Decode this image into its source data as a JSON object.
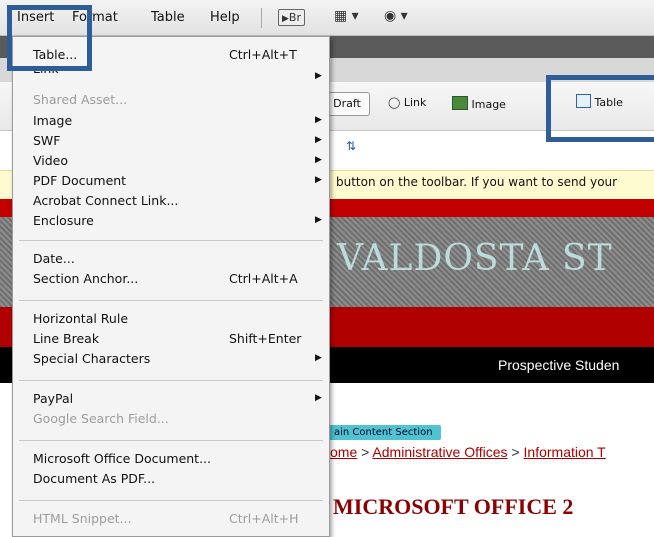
{
  "menubar": {
    "items": [
      "Insert",
      "Format",
      "Table",
      "Help"
    ],
    "br_icon_label": "Br"
  },
  "toolbar": {
    "draft_label": "Draft",
    "link_label": "Link",
    "image_label": "Image",
    "table_label": "Table"
  },
  "notice": {
    "text": "button on the toolbar. If you want to send your"
  },
  "page": {
    "banner_text": "VALDOSTA ST",
    "nav_text": "Prospective Studen",
    "content_tag": "ain Content Section",
    "breadcrumb": [
      "ome",
      "Administrative Offices",
      "Information T"
    ],
    "breadcrumb_sep": " > ",
    "heading": "MICROSOFT OFFICE 2"
  },
  "dropdown": {
    "items": [
      {
        "label": "Table...",
        "shortcut": "Ctrl+Alt+T",
        "disabled": false
      },
      {
        "label": "Link",
        "shortcut": "",
        "submenu": true
      },
      {
        "label": "Shared Asset...",
        "shortcut": "",
        "disabled": true
      },
      {
        "label": "Image",
        "shortcut": "",
        "submenu": true
      },
      {
        "label": "SWF",
        "shortcut": "",
        "submenu": true
      },
      {
        "label": "Video",
        "shortcut": "",
        "submenu": true
      },
      {
        "label": "PDF Document",
        "shortcut": "",
        "submenu": true
      },
      {
        "label": "Acrobat Connect Link...",
        "shortcut": ""
      },
      {
        "label": "Enclosure",
        "shortcut": "",
        "submenu": true
      },
      {
        "label": "Date...",
        "shortcut": ""
      },
      {
        "label": "Section Anchor...",
        "shortcut": "Ctrl+Alt+A"
      },
      {
        "label": "Horizontal Rule",
        "shortcut": ""
      },
      {
        "label": "Line Break",
        "shortcut": "Shift+Enter"
      },
      {
        "label": "Special Characters",
        "shortcut": "",
        "submenu": true
      },
      {
        "label": "PayPal",
        "shortcut": "",
        "submenu": true
      },
      {
        "label": "Google Search Field...",
        "shortcut": "",
        "disabled": true
      },
      {
        "label": "Microsoft Office Document...",
        "shortcut": ""
      },
      {
        "label": "Document As PDF...",
        "shortcut": ""
      },
      {
        "label": "HTML Snippet...",
        "shortcut": "Ctrl+Alt+H",
        "disabled": true
      }
    ]
  },
  "colors": {
    "highlight": "#2f5d97",
    "brand_red": "#c30000",
    "link_red": "#aa0000"
  }
}
